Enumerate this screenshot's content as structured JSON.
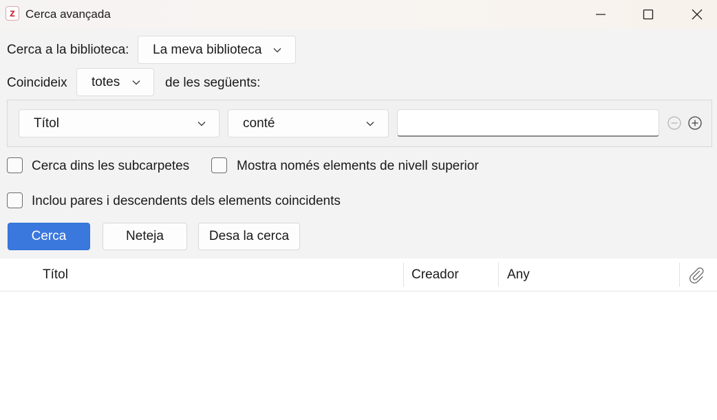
{
  "window": {
    "title": "Cerca avançada",
    "app_icon_letter": "z",
    "brand_color": "#cc2936"
  },
  "search": {
    "library_label": "Cerca a la biblioteca:",
    "library_value": "La meva biblioteca",
    "match_label": "Coincideix",
    "match_value": "totes",
    "match_suffix": "de les següents:"
  },
  "condition": {
    "field": "Títol",
    "operator": "conté",
    "value": "",
    "remove_icon": "minus-circle-icon",
    "add_icon": "plus-circle-icon"
  },
  "options": {
    "subfolders": {
      "label": "Cerca dins les subcarpetes",
      "checked": false
    },
    "top_level": {
      "label": "Mostra només elements de nivell superior",
      "checked": false
    },
    "parents": {
      "label": "Inclou pares i descendents dels elements coincidents",
      "checked": false
    }
  },
  "buttons": {
    "search": "Cerca",
    "clear": "Neteja",
    "save": "Desa la cerca",
    "accent_color": "#3a78dd"
  },
  "results": {
    "columns": [
      "Títol",
      "Creador",
      "Any"
    ],
    "attachment_icon": "paperclip-icon",
    "rows": []
  }
}
